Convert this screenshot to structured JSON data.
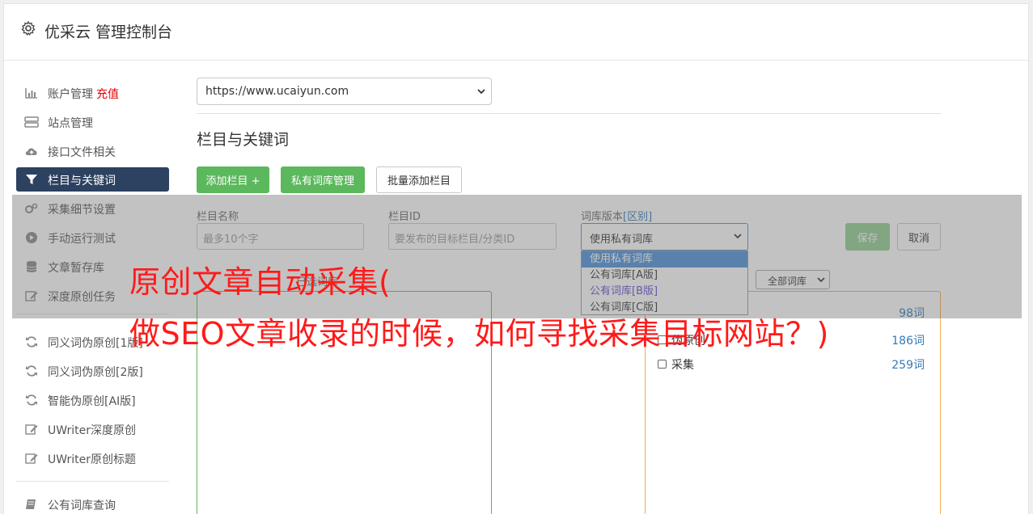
{
  "app": {
    "title": "优采云 管理控制台"
  },
  "sidebar": {
    "items": [
      {
        "label": "账户管理",
        "badge": "充值",
        "icon": "bar-chart-icon"
      },
      {
        "label": "站点管理",
        "icon": "server-icon"
      },
      {
        "label": "接口文件相关",
        "icon": "cloud-upload-icon"
      },
      {
        "label": "栏目与关键词",
        "icon": "filter-icon",
        "active": true
      },
      {
        "label": "采集细节设置",
        "icon": "gears-icon"
      },
      {
        "label": "手动运行测试",
        "icon": "play-circle-icon"
      },
      {
        "label": "文章暂存库",
        "icon": "database-icon"
      },
      {
        "label": "深度原创任务",
        "icon": "edit-icon"
      },
      {
        "label": "同义词伪原创[1版]",
        "icon": "refresh-icon"
      },
      {
        "label": "同义词伪原创[2版]",
        "icon": "refresh-icon"
      },
      {
        "label": "智能伪原创[AI版]",
        "icon": "refresh-icon"
      },
      {
        "label": "UWriter深度原创",
        "icon": "edit-icon"
      },
      {
        "label": "UWriter原创标题",
        "icon": "edit-icon"
      },
      {
        "label": "公有词库查询",
        "icon": "book-icon"
      }
    ]
  },
  "main": {
    "site_select": {
      "value": "https://www.ucaiyun.com"
    },
    "section_title": "栏目与关键词",
    "buttons": {
      "add_column": "添加栏目 +",
      "private_lib": "私有词库管理",
      "batch_add": "批量添加栏目"
    },
    "form": {
      "name_label": "栏目名称",
      "name_placeholder": "最多10个字",
      "id_label": "栏目ID",
      "id_placeholder": "要发布的目标栏目/分类ID",
      "lib_label": "词库版本",
      "lib_label_hint": "[区别]",
      "lib_value": "使用私有词库",
      "lib_options": [
        "使用私有词库",
        "公有词库[A版]",
        "公有词库[B版]",
        "公有词库[C版]"
      ],
      "save": "保存",
      "cancel": "取消"
    },
    "lib_filter": {
      "value": "全部词库"
    },
    "libraries": [
      {
        "name": "",
        "count": "98词"
      },
      {
        "name": "伪原创",
        "count": "186词"
      },
      {
        "name": "采集",
        "count": "259词"
      }
    ],
    "faint_label": "已选词库"
  },
  "overlay": {
    "headline_1": "原创文章自动采集(",
    "headline_2": "做SEO文章收录的时候，如何寻找采集目标网站？)"
  },
  "colors": {
    "sidebar_active": "#2d4160",
    "green": "#5cb85c",
    "headline": "#ff1a1a",
    "link": "#337ab7"
  }
}
